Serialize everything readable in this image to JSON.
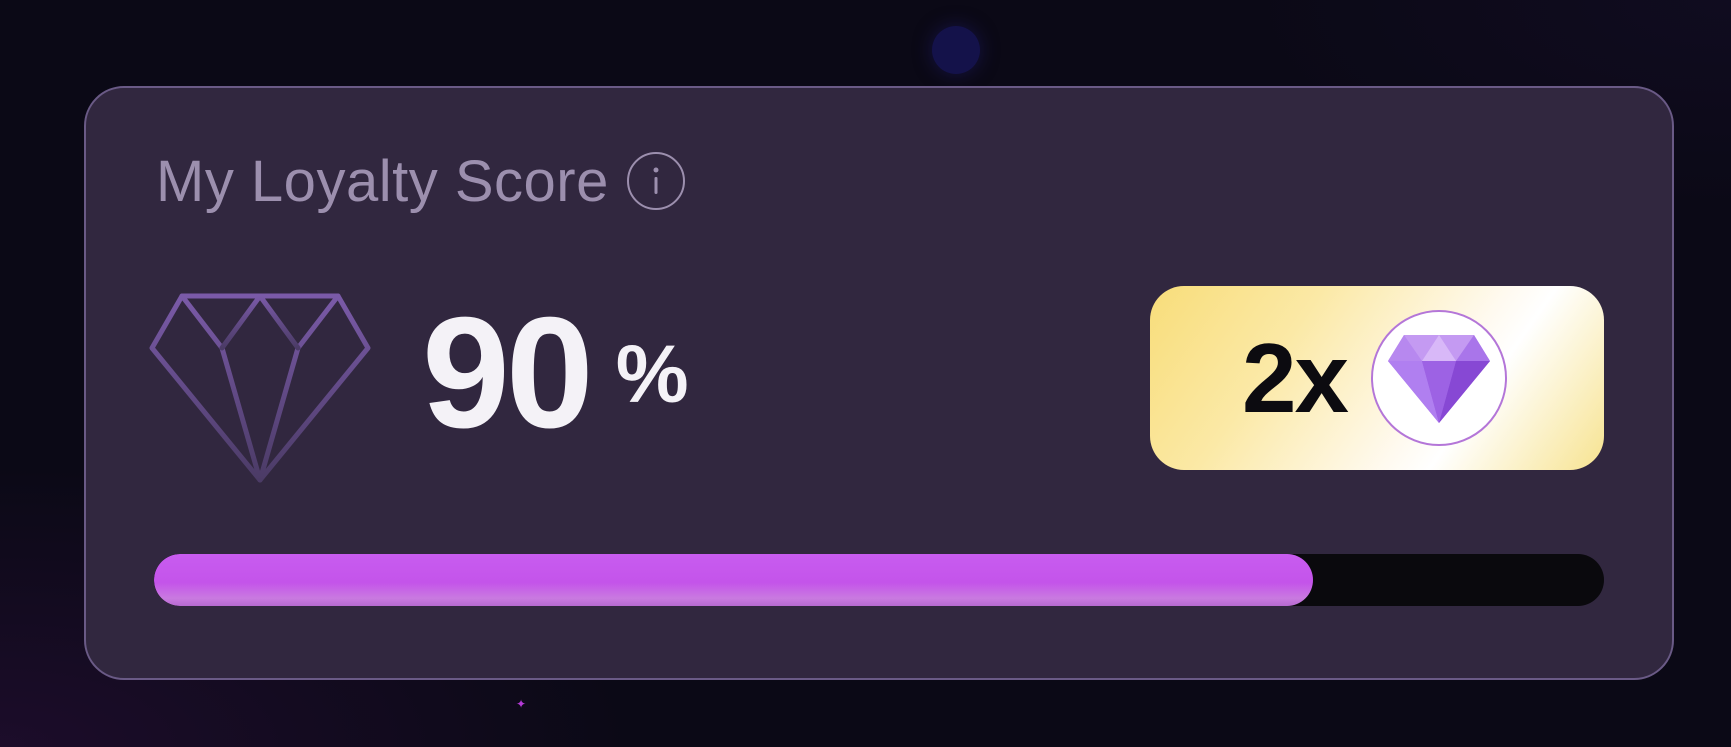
{
  "loyalty_card": {
    "title": "My Loyalty Score",
    "info_icon": "info-icon",
    "tier_icon": "diamond-outline-icon",
    "score_value": "90",
    "score_unit": "%",
    "progress_percent": 90,
    "multiplier": {
      "label": "2x",
      "icon": "diamond-gem-icon"
    }
  },
  "colors": {
    "card_background": "#31273f",
    "title_text": "#9c8fae",
    "score_text": "#f4f2f7",
    "progress_fill": "#c85cf0",
    "progress_track": "#0a090d",
    "badge_gold": "#f8dd7a",
    "gem_purple": "#a66ce6"
  }
}
